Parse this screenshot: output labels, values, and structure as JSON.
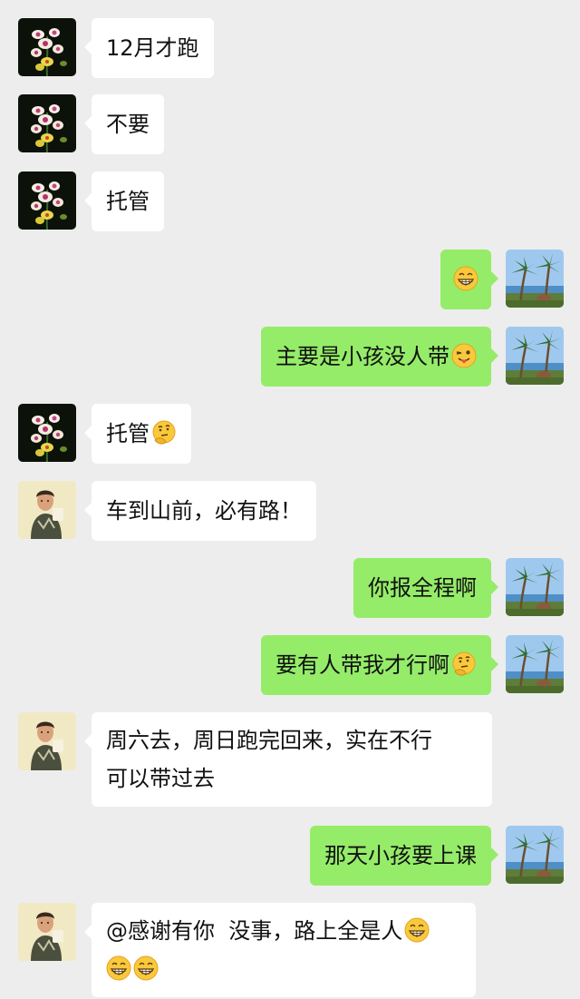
{
  "messages": [
    {
      "side": "left",
      "sender": "flower",
      "text": "12月才跑"
    },
    {
      "side": "left",
      "sender": "flower",
      "text": "不要"
    },
    {
      "side": "left",
      "sender": "flower",
      "text": "托管"
    },
    {
      "side": "right",
      "sender": "palm",
      "text": "",
      "emoji": [
        "grin-icon"
      ]
    },
    {
      "side": "right",
      "sender": "palm",
      "text": "主要是小孩没人带",
      "emoji": [
        "wink-tongue-icon"
      ]
    },
    {
      "side": "left",
      "sender": "flower",
      "text": "托管",
      "emoji": [
        "thinking-face-icon"
      ]
    },
    {
      "side": "left",
      "sender": "lady",
      "text": "车到山前，必有路！"
    },
    {
      "side": "right",
      "sender": "palm",
      "text": "你报全程啊"
    },
    {
      "side": "right",
      "sender": "palm",
      "text": "要有人带我才行啊",
      "emoji": [
        "thinking-face-icon"
      ]
    },
    {
      "side": "left",
      "sender": "lady",
      "line1": "周六去，周日跑完回来，实在不行",
      "line2": "可以带过去"
    },
    {
      "side": "right",
      "sender": "palm",
      "text": "那天小孩要上课"
    },
    {
      "side": "left",
      "sender": "lady",
      "line1": "@感谢有你  没事，路上全是人",
      "line2": "",
      "emoji": [
        "grin-icon",
        "grin-icon",
        "grin-icon"
      ]
    }
  ],
  "avatars": {
    "flower": "flower-avatar",
    "palm": "palm-tree-avatar",
    "lady": "woman-photo-avatar"
  },
  "colors": {
    "background": "#ededed",
    "incoming_bubble": "#ffffff",
    "outgoing_bubble": "#95ec69"
  }
}
